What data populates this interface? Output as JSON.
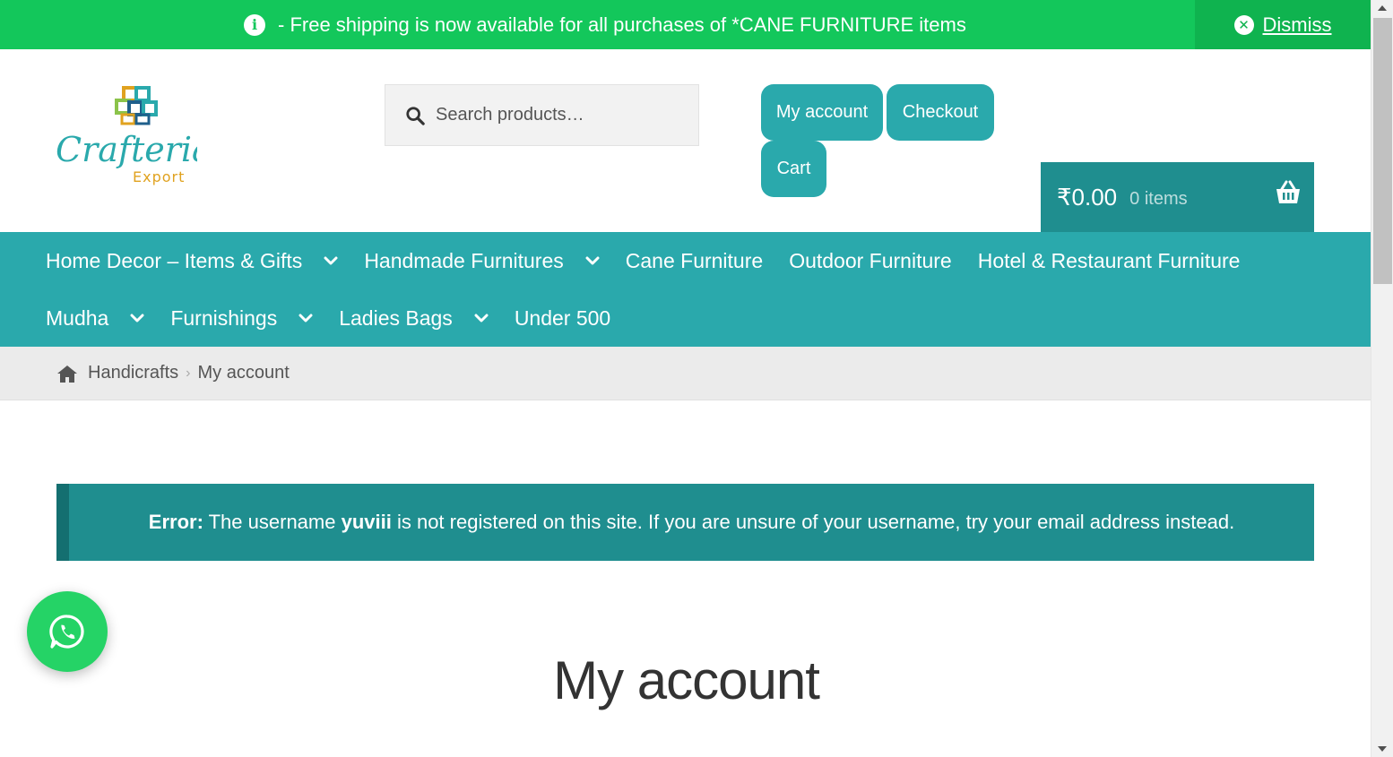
{
  "notice": {
    "text": "- Free shipping is now available for all purchases of *CANE FURNITURE items",
    "dismiss_label": "Dismiss"
  },
  "logo": {
    "brand": "Crafteria",
    "sub": "Export"
  },
  "search": {
    "placeholder": "Search products…"
  },
  "header_buttons": {
    "account": "My account",
    "checkout": "Checkout",
    "cart": "Cart"
  },
  "minicart": {
    "amount": "₹0.00",
    "count": "0 items"
  },
  "nav": {
    "row1": [
      {
        "label": "Home Decor – Items & Gifts",
        "dropdown": true
      },
      {
        "label": "Handmade Furnitures",
        "dropdown": true
      },
      {
        "label": "Cane Furniture",
        "dropdown": false
      },
      {
        "label": "Outdoor Furniture",
        "dropdown": false
      },
      {
        "label": "Hotel & Restaurant Furniture",
        "dropdown": false
      }
    ],
    "row2": [
      {
        "label": "Mudha",
        "dropdown": true
      },
      {
        "label": "Furnishings",
        "dropdown": true
      },
      {
        "label": "Ladies Bags",
        "dropdown": true
      },
      {
        "label": "Under 500",
        "dropdown": false
      }
    ]
  },
  "breadcrumb": {
    "home": "Handicrafts",
    "current": "My account"
  },
  "error": {
    "prefix": "Error:",
    "text_a": " The username ",
    "username": "yuviii",
    "text_b": " is not registered on this site. If you are unsure of your username, try your email address instead."
  },
  "page": {
    "title": "My account"
  },
  "colors": {
    "primary": "#2aa9ac",
    "notice": "#13c75b",
    "error_bg": "#1f8e8f",
    "whatsapp": "#25d366"
  }
}
